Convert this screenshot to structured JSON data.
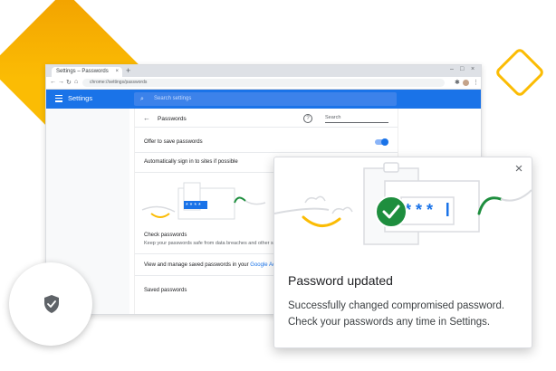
{
  "browser": {
    "tab_title": "Settings – Passwords",
    "tab_close": "×",
    "new_tab": "+",
    "url": "chrome://settings/passwords",
    "nav": {
      "back": "←",
      "forward": "→",
      "reload": "↻",
      "home": "⌂"
    },
    "window_controls": {
      "minimize": "–",
      "maximize": "□",
      "close": "×"
    },
    "extensions": {
      "puzzle": "✱",
      "menu": "⋮"
    }
  },
  "settings": {
    "title": "Settings",
    "search_placeholder": "Search settings",
    "search_icon": "⌕"
  },
  "passwords": {
    "back": "←",
    "title": "Passwords",
    "help": "?",
    "search_placeholder": "Search",
    "offer_to_save": "Offer to save passwords",
    "offer_to_save_enabled": true,
    "auto_sign_in": "Automatically sign in to sites if possible",
    "check_title": "Check passwords",
    "check_desc": "Keep your passwords safe from data breaches and other se",
    "manage_text": "View and manage saved passwords in your ",
    "manage_link": "Google Accoun",
    "saved_passwords": "Saved passwords"
  },
  "popup": {
    "close": "×",
    "title": "Password updated",
    "line1": "Successfully changed compromised password.",
    "line2": "Check your passwords any time in Settings."
  },
  "colors": {
    "accent_blue": "#1a73e8",
    "check_green": "#1e8e3e",
    "brand_yellow": "#fbbc04"
  },
  "icons": [
    "menu-icon",
    "search-icon",
    "back-arrow-icon",
    "help-icon",
    "checkmark-icon",
    "shield-icon",
    "close-icon",
    "clipboard-icon"
  ]
}
